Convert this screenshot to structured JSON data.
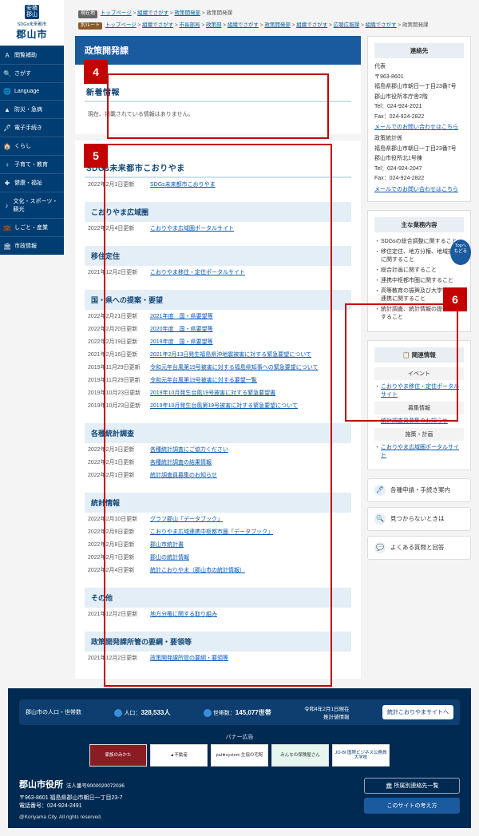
{
  "logo": {
    "badge_top": "安積",
    "badge_bot": "郡山",
    "sub": "SDGs未来都市",
    "city": "郡山市"
  },
  "sidenav": [
    {
      "icon": "A",
      "label": "閲覧補助"
    },
    {
      "icon": "🔍",
      "label": "さがす"
    },
    {
      "icon": "🌐",
      "label": "Language"
    },
    {
      "icon": "▲",
      "label": "防災・急病"
    },
    {
      "icon": "🖋",
      "label": "電子手続き"
    },
    {
      "icon": "🏠",
      "label": "くらし"
    },
    {
      "icon": "♀",
      "label": "子育て・教育"
    },
    {
      "icon": "✚",
      "label": "健康・福祉"
    },
    {
      "icon": "♪",
      "label": "文化・スポーツ・観光"
    },
    {
      "icon": "💼",
      "label": "しごと・産業"
    },
    {
      "icon": "🏛",
      "label": "市政情報"
    }
  ],
  "bc1": {
    "tag": "現在地",
    "items": [
      "トップページ",
      "組織でさがす",
      "政策開発部"
    ],
    "current": "政策開発課"
  },
  "bc2": {
    "tag": "別ルート",
    "items": [
      "トップページ",
      "組織でさがす",
      "市長部局",
      "政策部",
      "組織でさがす",
      "政策開発部",
      "組織でさがす",
      "広聴広報課",
      "組織でさがす"
    ],
    "current": "政策開発課"
  },
  "page_title": "政策開発課",
  "news": {
    "heading": "新着情報",
    "empty": "現在、掲載されている情報はありません。"
  },
  "sdgs_h": "SDGs未来都市こおりやま",
  "categories": [
    {
      "title": "",
      "items": [
        {
          "date": "2022年2月1日更新",
          "link": "SDGs未来都市こおりやま"
        }
      ]
    },
    {
      "title": "こおりやま広域圏",
      "items": [
        {
          "date": "2022年2月4日更新",
          "link": "こおりやま広域圏ポータルサイト"
        }
      ]
    },
    {
      "title": "移住定住",
      "items": [
        {
          "date": "2021年12月2日更新",
          "link": "こおりやま移住・定住ポータルサイト"
        }
      ]
    },
    {
      "title": "国・県への提案・要望",
      "items": [
        {
          "date": "2022年2月21日更新",
          "link": "2021年度　国・県要望等"
        },
        {
          "date": "2022年2月20日更新",
          "link": "2020年度　国・県要望等"
        },
        {
          "date": "2022年2月19日更新",
          "link": "2019年度　国・県要望等"
        },
        {
          "date": "2021年2月16日更新",
          "link": "2021年2月13日発生福島県沖地震被害に対する緊急要望について"
        },
        {
          "date": "2019年11月29日更新",
          "link": "令和元年台風第19号被害に対する福島県知事への緊急要望について"
        },
        {
          "date": "2019年11月29日更新",
          "link": "令和元年台風第19号被害に対する要望一覧"
        },
        {
          "date": "2019年10月23日更新",
          "link": "2019年10月発生台風19号被害に対する緊急要望書"
        },
        {
          "date": "2019年10月23日更新",
          "link": "2019年10月発生台風第19号被害に対する緊急要望について"
        }
      ]
    },
    {
      "title": "各種統計調査",
      "items": [
        {
          "date": "2022年2月3日更新",
          "link": "各種統計調査にご協力ください"
        },
        {
          "date": "2022年2月1日更新",
          "link": "各種統計調査の結果情報"
        },
        {
          "date": "2022年2月1日更新",
          "link": "統計調査員募集のお知らせ"
        }
      ]
    },
    {
      "title": "統計情報",
      "items": [
        {
          "date": "2022年2月10日更新",
          "link": "グラフ郡山「データブック」"
        },
        {
          "date": "2022年2月9日更新",
          "link": "こおりやま広域連携中枢都市圏「データブック」"
        },
        {
          "date": "2022年2月8日更新",
          "link": "郡山市統計書"
        },
        {
          "date": "2022年2月7日更新",
          "link": "郡山の統計情報"
        },
        {
          "date": "2022年2月4日更新",
          "link": "統計こおりやま（郡山市の統計情報）"
        }
      ]
    },
    {
      "title": "その他",
      "items": [
        {
          "date": "2021年12月2日更新",
          "link": "地方分権に関する取り組み"
        }
      ]
    },
    {
      "title": "政策開発課所管の要綱・要領等",
      "items": [
        {
          "date": "2021年12月2日更新",
          "link": "政策開発課所管の要綱・要領等"
        }
      ]
    }
  ],
  "contact": {
    "title": "連絡先",
    "l1": "代表",
    "l2": "〒963-8601",
    "l3": "福島県郡山市朝日一丁目23番7号",
    "l4": "郡山市役所本庁舎2階",
    "l5": "Tel：024-924-2021",
    "l6": "Fax：024-924-2822",
    "link1": "メールでのお問い合わせはこちら",
    "l7": "政策統計係",
    "l8": "福島県郡山市朝日一丁目23番7号",
    "l9": "郡山市役所北1号棟",
    "l10": "Tel：024-924-2047",
    "l11": "Fax：024-924-2822",
    "link2": "メールでのお問い合わせはこちら"
  },
  "duties": {
    "title": "主な業務内容",
    "items": [
      "SDGsの総合調整に関すること",
      "移住定住、地方分権、地域振興に関すること",
      "総合計画に関すること",
      "連携中枢都市圏に関すること",
      "高等教育の振興及び大学等との連携に関すること",
      "統計調査、統計情報の提供に関すること"
    ]
  },
  "related": {
    "title": "関連情報",
    "g1": "イベント",
    "g1_link": "こおりやま移住・定住ポータルサイト",
    "g2": "募集情報",
    "g2_link": "統計調査員募集のお知らせ",
    "g3": "施策・計画",
    "g3_link": "こおりやま広域圏ポータルサイト"
  },
  "aside_btns": [
    {
      "icon": "🖊",
      "label": "各種申請・手続き案内"
    },
    {
      "icon": "🔍",
      "label": "見つからないときは"
    },
    {
      "icon": "💬",
      "label": "よくある質問と回答"
    }
  ],
  "float": {
    "l1": "Topへ",
    "l2": "もどる"
  },
  "footer": {
    "stats_lbl": "郡山市の人口・世帯数",
    "pop_lbl": "人口：",
    "pop": "328,533人",
    "hh_lbl": "世帯数：",
    "hh": "145,077世帯",
    "asof": "令和4年2月1日現在",
    "asof2": "推計値情報",
    "stats_btn": "統計こおりやまサイトへ",
    "banner_lbl": "バナー広告",
    "banners": [
      "家族のみかた",
      "▲不動産",
      "pal★system 生協の宅配",
      "みんなの保険屋さん",
      "JO-BI 国際ビジネス公務員大学校"
    ],
    "office": "郡山市役所",
    "corp": "法人番号9000020072036",
    "addr": "〒963-8601  福島県郡山市朝日一丁目23-7",
    "tel": "電話番号：024-924-2491",
    "copy": "@Koriyama City. All rights reserved.",
    "btn1": "所属別連絡先一覧",
    "btn2": "このサイトの考え方"
  }
}
